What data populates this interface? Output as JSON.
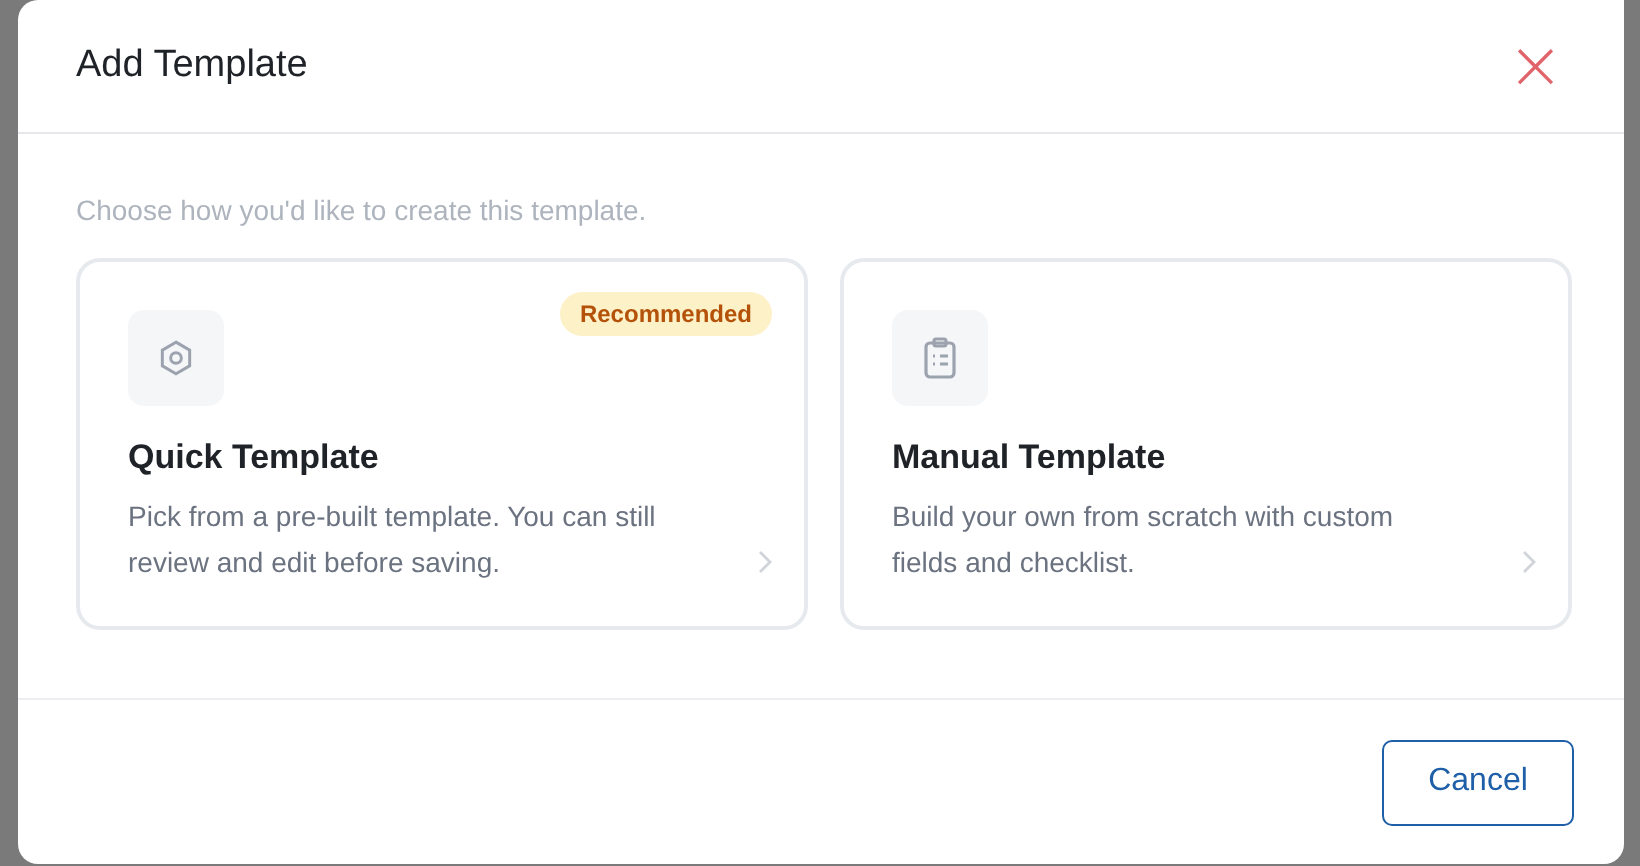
{
  "dialog": {
    "title": "Add Template",
    "close": "×"
  },
  "prompt": "Choose how you'd like to create this template.",
  "options": [
    {
      "kind": "preset",
      "title": "Quick Template",
      "description": "Pick from a pre-built template. You can still review and edit before saving.",
      "badge": "Recommended"
    },
    {
      "kind": "custom",
      "title": "Manual Template",
      "description": "Build your own from scratch with custom fields and checklist."
    }
  ],
  "buttons": [
    "Cancel"
  ]
}
